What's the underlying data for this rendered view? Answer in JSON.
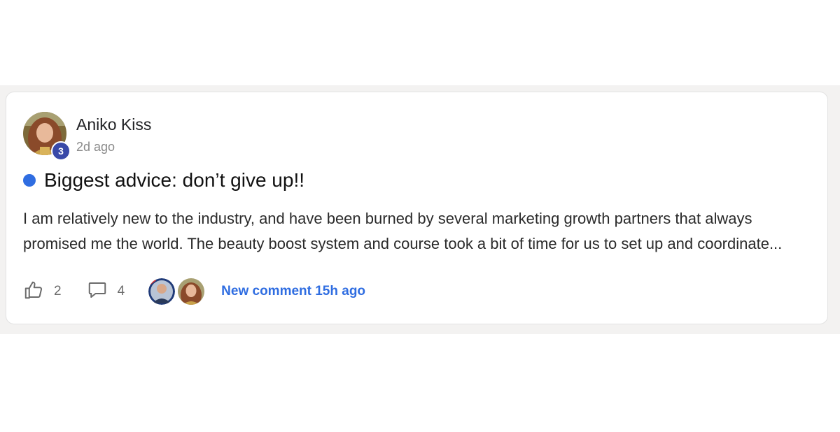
{
  "post": {
    "author": {
      "name": "Aniko Kiss",
      "level": "3",
      "timestamp": "2d ago"
    },
    "title": "Biggest advice: don’t give up!!",
    "body": "I am relatively new to the industry, and have been burned by several marketing growth partners that always promised me the world. The beauty boost system and course took a bit of time for us to set up and coordinate...",
    "likes": "2",
    "comments": "4",
    "new_comment": "New comment 15h ago"
  },
  "icons": {
    "like": "thumbs-up-icon",
    "comment": "speech-bubble-icon",
    "unread": "blue-dot"
  },
  "colors": {
    "accent": "#2f6de1",
    "level_badge": "#3949a8",
    "unread_dot": "#2f6de1"
  }
}
